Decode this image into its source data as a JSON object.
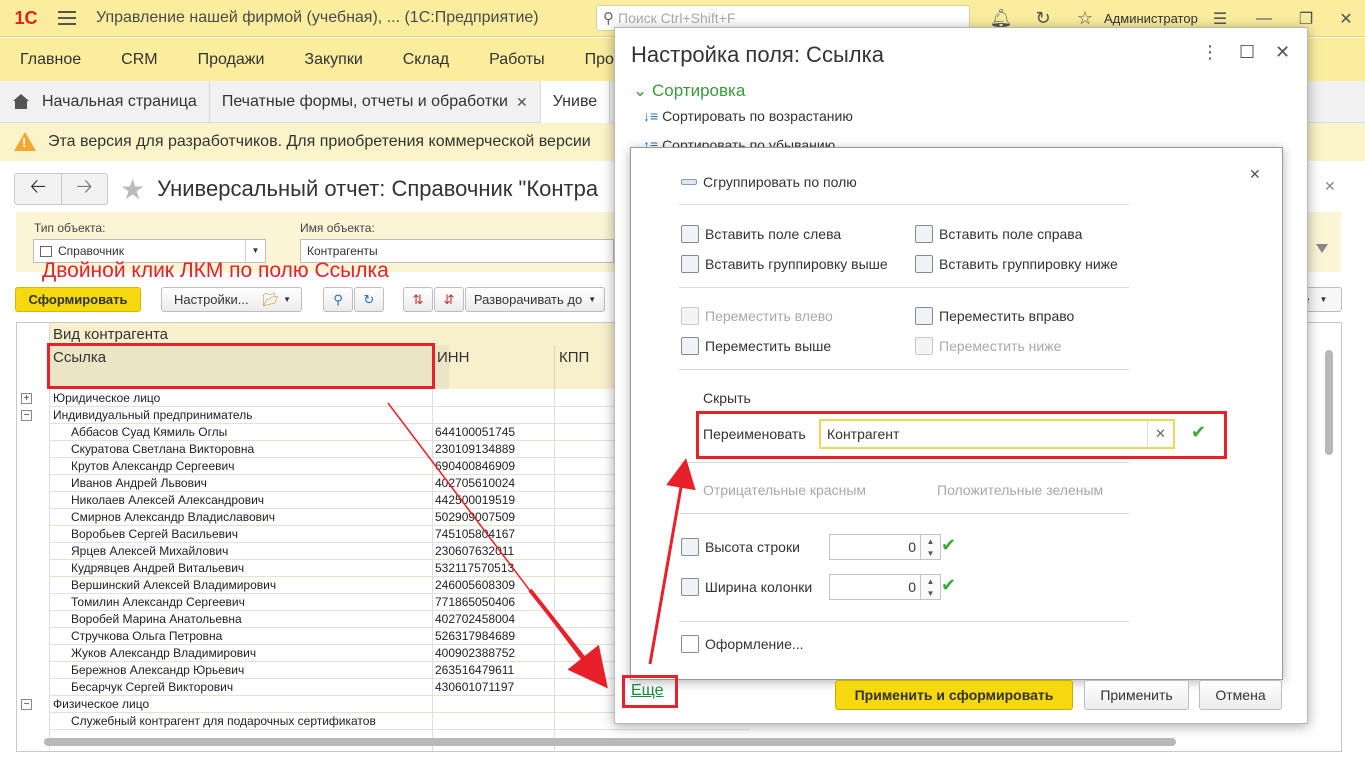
{
  "app": {
    "logo": "1С",
    "title": "Управление нашей фирмой (учебная), ...   (1С:Предприятие)",
    "search_placeholder": "Поиск Ctrl+Shift+F",
    "user": "Администратор"
  },
  "menu": [
    "Главное",
    "CRM",
    "Продажи",
    "Закупки",
    "Склад",
    "Работы",
    "Про"
  ],
  "tabs": {
    "home": "Начальная страница",
    "print": "Печатные формы, отчеты и обработки",
    "active": "Униве"
  },
  "notice": "Эта версия для разработчиков. Для приобретения коммерческой версии",
  "report": {
    "title": "Универсальный отчет: Справочник \"Контра",
    "object_type_label": "Тип объекта:",
    "object_type_value": "Справочник",
    "object_name_label": "Имя объекта:",
    "object_name_value": "Контрагенты",
    "annotation": "Двойной клик ЛКМ по полю Ссылка",
    "btn_generate": "Сформировать",
    "btn_settings": "Настройки...",
    "btn_expand": "Разворачивать до",
    "btn_right": "це"
  },
  "grid": {
    "group_header": "Вид контрагента",
    "col_link": "Ссылка",
    "col_inn": "ИНН",
    "col_kpp": "КПП",
    "groups": {
      "legal": "Юридическое лицо",
      "individual": "Индивидуальный предприниматель",
      "physical": "Физическое лицо"
    },
    "rows": [
      {
        "name": "Аббасов Суад Кямиль Оглы",
        "inn": "644100051745"
      },
      {
        "name": "Скуратова Светлана Викторовна",
        "inn": "230109134889"
      },
      {
        "name": "Крутов Александр Сергеевич",
        "inn": "690400846909"
      },
      {
        "name": "Иванов Андрей Львович",
        "inn": "402705610024"
      },
      {
        "name": "Николаев Алексей Александрович",
        "inn": "442500019519"
      },
      {
        "name": "Смирнов Александр Владиславович",
        "inn": "502909007509"
      },
      {
        "name": "Воробьев Сергей Васильевич",
        "inn": "745105804167"
      },
      {
        "name": "Ярцев Алексей Михайлович",
        "inn": "230607632011"
      },
      {
        "name": "Кудрявцев Андрей Витальевич",
        "inn": "532117570513"
      },
      {
        "name": "Вершинский Алексей Владимирович",
        "inn": "246005608309"
      },
      {
        "name": "Томилин Александр Сергеевич",
        "inn": "771865050406"
      },
      {
        "name": "Воробей Марина Анатольевна",
        "inn": "402702458004"
      },
      {
        "name": "Стручкова Ольга Петровна",
        "inn": "526317984689"
      },
      {
        "name": "Жуков Александр Владимирович",
        "inn": "400902388752"
      },
      {
        "name": "Бережнов Александр Юрьевич",
        "inn": "263516479611"
      },
      {
        "name": "Бесарчук Сергей Викторович",
        "inn": "430601071197"
      }
    ],
    "physical_row": "Служебный контрагент для подарочных сертификатов"
  },
  "dialog": {
    "title": "Настройка поля: Ссылка",
    "sort_header": "Сортировка",
    "sort_asc": "Сортировать по возрастанию",
    "sort_desc": "Сортировать по убыванию",
    "more": "Еще",
    "btn_apply_generate": "Применить и сформировать",
    "btn_apply": "Применить",
    "btn_cancel": "Отмена"
  },
  "popup": {
    "group_by": "Сгруппировать по полю",
    "insert_left": "Вставить поле слева",
    "insert_right": "Вставить поле справа",
    "insert_group_above": "Вставить группировку выше",
    "insert_group_below": "Вставить группировку ниже",
    "move_left": "Переместить влево",
    "move_right": "Переместить вправо",
    "move_up": "Переместить выше",
    "move_down": "Переместить ниже",
    "hide": "Скрыть",
    "rename_label": "Переименовать",
    "rename_value": "Контрагент",
    "negative_red": "Отрицательные красным",
    "positive_green": "Положительные зеленым",
    "row_height_label": "Высота строки",
    "row_height_value": "0",
    "col_width_label": "Ширина колонки",
    "col_width_value": "0",
    "format": "Оформление..."
  },
  "colors": {
    "accent_yellow": "#fbed9e",
    "annotation_red": "#e8202a",
    "link_green": "#1a8a3a",
    "button_yellow": "#f6d80f"
  }
}
